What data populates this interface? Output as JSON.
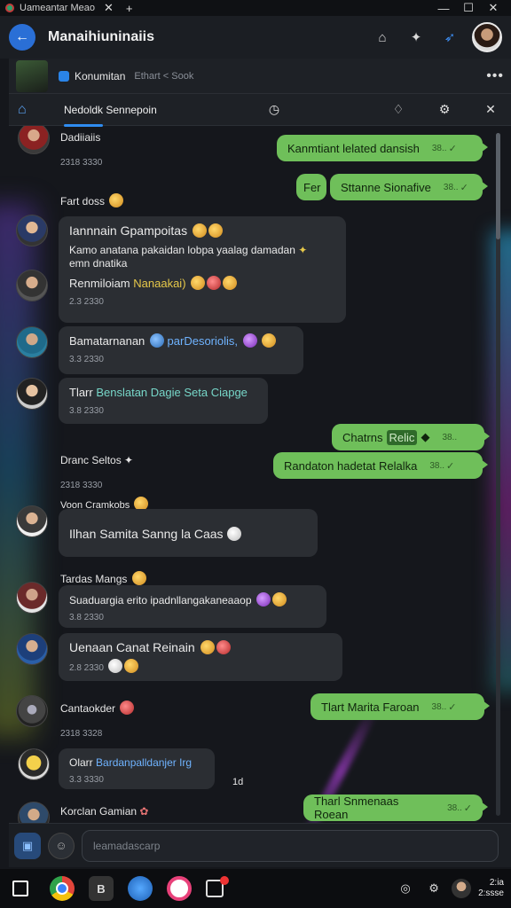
{
  "window": {
    "title": "Uameantar Meao",
    "close_tab": "✕",
    "new_tab": "+"
  },
  "header": {
    "title": "Manaihiuninaiis",
    "back_icon": "arrow-left-icon"
  },
  "subheader": {
    "name": "Konumitan",
    "meta": "Ethart < Sook",
    "more": "•••"
  },
  "tabs": {
    "active_label": "Nedoldk Sennepoin"
  },
  "messages": {
    "top_name": "Dadiiaiis",
    "top_time": "2318 3330",
    "out1": {
      "text": "Kanmtiant lelated dansish",
      "time": "38.."
    },
    "out2a": {
      "text": "Fer"
    },
    "out2b": {
      "text": "Sttanne Sionafive",
      "time": "38.."
    },
    "label_fart": "Fart doss",
    "m1": {
      "title": "Iannnain Gpampoitas",
      "body1": "Kamo anatana pakaidan lobpa yaalag damadan",
      "body2": "emn dnatika",
      "body3a": "Renmiloiam",
      "body3b": "Nanaakai)",
      "time": "2.3 2330"
    },
    "m2": {
      "text_a": "Bamatarnanan",
      "text_b": "parDesoriolis,",
      "time": "3.3 2330"
    },
    "m3": {
      "text_a": "Tlarr",
      "text_b": "Benslatan Dagie Seta Ciapge",
      "time": "3.8 2330"
    },
    "out3": {
      "text": "Chatrns",
      "hl": "Relic",
      "time": "38.."
    },
    "out4": {
      "text": "Randaton hadetat Relalka",
      "time": "38.."
    },
    "label_dranc": "Dranc Seltos",
    "label_dranc_time": "2318 3330",
    "label_voon": "Voon Cramkobs",
    "m4": {
      "text": "Ilhan Samita Sanng la Caas"
    },
    "label_tarsas": "Tardas Mangs",
    "m5": {
      "text": "Suaduargia erito ipadnllangakaneaaop",
      "time": "3.8 2330"
    },
    "m6": {
      "text": "Uenaan Canat Reinain",
      "time": "2.8 2330"
    },
    "out5": {
      "text": "Tlart Marita Faroan",
      "time": "38.."
    },
    "label_cantaokder": "Cantaokder",
    "label_cantaokder_time": "2318 3328",
    "m7": {
      "text_a": "Olarr",
      "text_b": "Bardanpalldanjer Irg",
      "time": "3.3 3330"
    },
    "stray": "1d",
    "label_korclan": "Korclan Gamian",
    "out6": {
      "text": "Tharl Snmenaas Roean",
      "time": "38.."
    }
  },
  "composer": {
    "placeholder": "leamadascarp"
  },
  "taskbar": {
    "clock_line1": "2:ia",
    "clock_line2": "2:ssse"
  },
  "colors": {
    "accent": "#2f8cf0",
    "outgoing_bubble": "#6fbf5a",
    "incoming_bubble": "#2b2e33"
  }
}
